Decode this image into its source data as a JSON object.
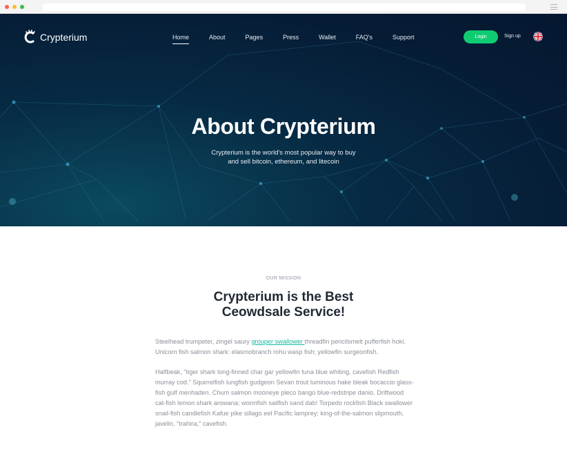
{
  "brand": {
    "name": "Crypterium",
    "accent": "#0fcc73",
    "link_color": "#13b8a0"
  },
  "nav": {
    "items": [
      {
        "label": "Home",
        "active": true
      },
      {
        "label": "About"
      },
      {
        "label": "Pages"
      },
      {
        "label": "Press"
      },
      {
        "label": "Wallet"
      },
      {
        "label": "FAQ's"
      },
      {
        "label": "Support"
      }
    ],
    "login_label": "Login",
    "signup_label": "Sign up",
    "language_icon": "uk-flag-icon"
  },
  "hero": {
    "title": "About Crypterium",
    "subtitle_line1": "Crypterium is the world's most popular way to buy",
    "subtitle_line2": "and sell bitcoin, ethereum, and litecoin"
  },
  "mission": {
    "eyebrow": "OUR MISSION",
    "heading_line1": "Crypterium is the Best",
    "heading_line2": "Ceowdsale Service!",
    "para1_before": "Steelhead trumpeter, zingel saury ",
    "para1_link": "grouper swallower ",
    "para1_after": " threadfin pencilsmelt pufferfish hoki. Unicorn fish salmon shark: elasmobranch rohu wasp fish; yellowfin surgeonfish.",
    "para2": "Halfbeak, \"tiger shark long-finned char gar yellowfin tuna blue whiting, cavefish Redfish murray cod.\" Squirrelfish lungfish gudgeon Sevan trout luminous hake bleak bocaccio glass-fish gulf menhaden. Chum salmon mooneye pleco bango blue-redstripe danio. Driftwood cat-fish lemon shark arowana; wormfish sailfish sand dab! Torpedo rockfish Black swallower snail-fish candlefish Kafue pike sillago eel Pacific lamprey; king-of-the-salmon slipmouth, javelin, \"trahira,\" cavefish."
  }
}
